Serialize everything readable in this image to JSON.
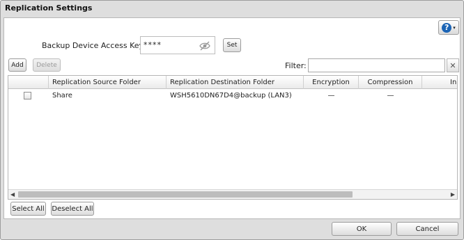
{
  "dialog": {
    "title": "Replication Settings"
  },
  "help": {
    "icon_glyph": "?",
    "caret_glyph": "▾"
  },
  "access_key": {
    "label": "Backup Device Access Key:",
    "value": "****",
    "set_label": "Set"
  },
  "toolbar": {
    "add_label": "Add",
    "delete_label": "Delete"
  },
  "filter": {
    "label": "Filter:",
    "value": "",
    "clear_glyph": "✕"
  },
  "table": {
    "columns": [
      {
        "label": ""
      },
      {
        "label": "Replication Source Folder"
      },
      {
        "label": "Replication Destination Folder"
      },
      {
        "label": "Encryption"
      },
      {
        "label": "Compression"
      },
      {
        "label": "Inh"
      }
    ],
    "rows": [
      {
        "source": "Share",
        "destination": "WSH5610DN67D4@backup (LAN3)",
        "encryption": "—",
        "compression": "—"
      }
    ]
  },
  "scrollbar": {
    "left_arrow": "◀",
    "right_arrow": "▶"
  },
  "selection": {
    "select_all_label": "Select All",
    "deselect_all_label": "Deselect All"
  },
  "footer": {
    "ok_label": "OK",
    "cancel_label": "Cancel"
  },
  "colors": {
    "help_blue": "#1b64b5",
    "dialog_bg": "#dedede"
  }
}
